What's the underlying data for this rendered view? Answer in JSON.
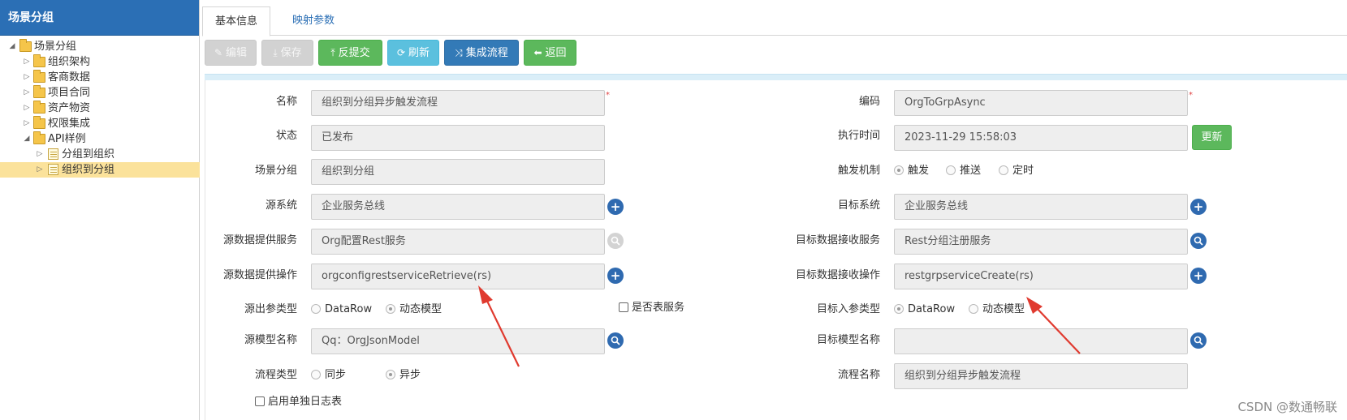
{
  "sidebar": {
    "title": "场景分组",
    "tree": [
      {
        "label": "场景分组",
        "type": "folder",
        "expanded": true,
        "level": 0
      },
      {
        "label": "组织架构",
        "type": "folder",
        "level": 1
      },
      {
        "label": "客商数据",
        "type": "folder",
        "level": 1
      },
      {
        "label": "项目合同",
        "type": "folder",
        "level": 1
      },
      {
        "label": "资产物资",
        "type": "folder",
        "level": 1
      },
      {
        "label": "权限集成",
        "type": "folder",
        "level": 1
      },
      {
        "label": "API样例",
        "type": "folder",
        "expanded": true,
        "level": 1
      },
      {
        "label": "分组到组织",
        "type": "file",
        "level": 2
      },
      {
        "label": "组织到分组",
        "type": "file",
        "level": 2,
        "selected": true
      }
    ]
  },
  "tabs": [
    {
      "label": "基本信息",
      "active": true
    },
    {
      "label": "映射参数",
      "active": false
    }
  ],
  "toolbar": {
    "edit": "编辑",
    "save": "保存",
    "unsubmit": "反提交",
    "refresh": "刷新",
    "integration_flow": "集成流程",
    "back": "返回"
  },
  "form": {
    "name": {
      "label": "名称",
      "value": "组织到分组异步触发流程",
      "required": "*"
    },
    "code": {
      "label": "编码",
      "value": "OrgToGrpAsync",
      "required": "*"
    },
    "status": {
      "label": "状态",
      "value": "已发布"
    },
    "exec_time": {
      "label": "执行时间",
      "value": "2023-11-29 15:58:03",
      "button": "更新"
    },
    "scene_group": {
      "label": "场景分组",
      "value": "组织到分组"
    },
    "trigger": {
      "label": "触发机制",
      "options": [
        "触发",
        "推送",
        "定时"
      ],
      "selected": "触发"
    },
    "source_system": {
      "label": "源系统",
      "value": "企业服务总线"
    },
    "target_system": {
      "label": "目标系统",
      "value": "企业服务总线"
    },
    "source_service": {
      "label": "源数据提供服务",
      "value": "Org配置Rest服务"
    },
    "target_service": {
      "label": "目标数据接收服务",
      "value": "Rest分组注册服务"
    },
    "source_operation": {
      "label": "源数据提供操作",
      "value": "orgconfigrestserviceRetrieve(rs)"
    },
    "target_operation": {
      "label": "目标数据接收操作",
      "value": "restgrpserviceCreate(rs)"
    },
    "source_out_type": {
      "label": "源出参类型",
      "options": [
        "DataRow",
        "动态模型"
      ],
      "selected": "动态模型"
    },
    "is_table_service": {
      "label": "是否表服务",
      "checked": false
    },
    "target_in_type": {
      "label": "目标入参类型",
      "options": [
        "DataRow",
        "动态模型"
      ],
      "selected": "DataRow"
    },
    "source_model": {
      "label": "源模型名称",
      "value": "Qq：OrgJsonModel"
    },
    "target_model": {
      "label": "目标模型名称",
      "value": ""
    },
    "flow_type": {
      "label": "流程类型",
      "options": [
        "同步",
        "异步"
      ],
      "selected": "异步"
    },
    "flow_name": {
      "label": "流程名称",
      "value": "组织到分组异步触发流程"
    },
    "separate_log": {
      "label": "启用单独日志表",
      "checked": false
    }
  },
  "watermark": "CSDN @数通畅联",
  "colors": {
    "header_blue": "#2b6fb5",
    "green": "#5cb85c",
    "cyan": "#5bc0de",
    "blue": "#337ab7",
    "annotation_red": "#e03a2f"
  }
}
